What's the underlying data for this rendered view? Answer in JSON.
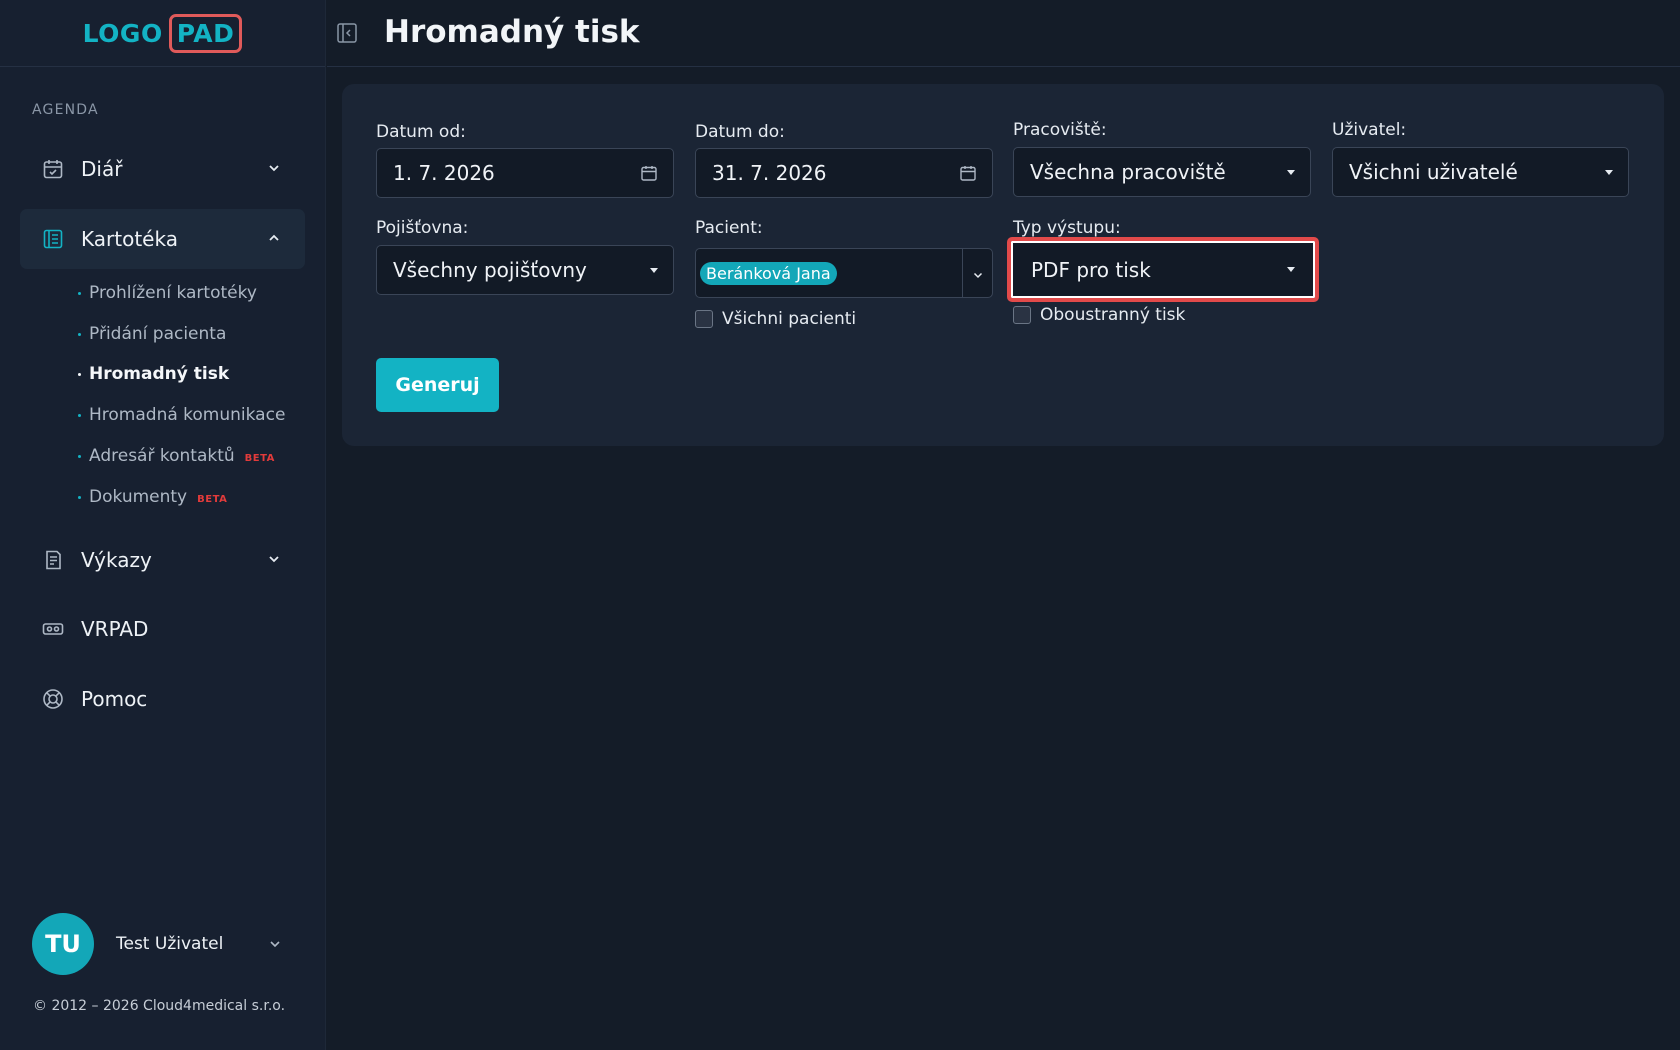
{
  "brand": {
    "logo_left": "LOGO",
    "logo_right": "PAD"
  },
  "sidebar": {
    "section": "AGENDA",
    "items": [
      {
        "label": "Diář",
        "icon": "calendar-check-icon"
      },
      {
        "label": "Kartotéka",
        "icon": "card-file-icon"
      },
      {
        "label": "Výkazy",
        "icon": "report-icon"
      },
      {
        "label": "VRPAD",
        "icon": "vr-headset-icon"
      },
      {
        "label": "Pomoc",
        "icon": "lifebuoy-icon"
      }
    ],
    "submenu": [
      {
        "label": "Prohlížení kartotéky"
      },
      {
        "label": "Přidání pacienta"
      },
      {
        "label": "Hromadný tisk"
      },
      {
        "label": "Hromadná komunikace"
      },
      {
        "label": "Adresář kontaktů",
        "badge": "BETA"
      },
      {
        "label": "Dokumenty",
        "badge": "BETA"
      }
    ],
    "user": {
      "initials": "TU",
      "name": "Test Uživatel"
    },
    "copyright": "© 2012 – 2026 Cloud4medical s.r.o."
  },
  "header": {
    "title": "Hromadný tisk"
  },
  "form": {
    "date_from": {
      "label": "Datum od:",
      "value": "1. 7. 2026"
    },
    "date_to": {
      "label": "Datum do:",
      "value": "31. 7. 2026"
    },
    "workplace": {
      "label": "Pracoviště:",
      "value": "Všechna pracoviště"
    },
    "user": {
      "label": "Uživatel:",
      "value": "Všichni uživatelé"
    },
    "insurance": {
      "label": "Pojišťovna:",
      "value": "Všechny pojišťovny"
    },
    "patient": {
      "label": "Pacient:",
      "chip": "Beránková Jana",
      "all_label": "Všichni pacienti"
    },
    "output_type": {
      "label": "Typ výstupu:",
      "value": "PDF pro tisk",
      "duplex_label": "Oboustranný tisk"
    },
    "generate_label": "Generuj"
  },
  "colors": {
    "accent": "#13b3c4",
    "highlight": "#e24a4a",
    "beta": "#e23b3b"
  }
}
